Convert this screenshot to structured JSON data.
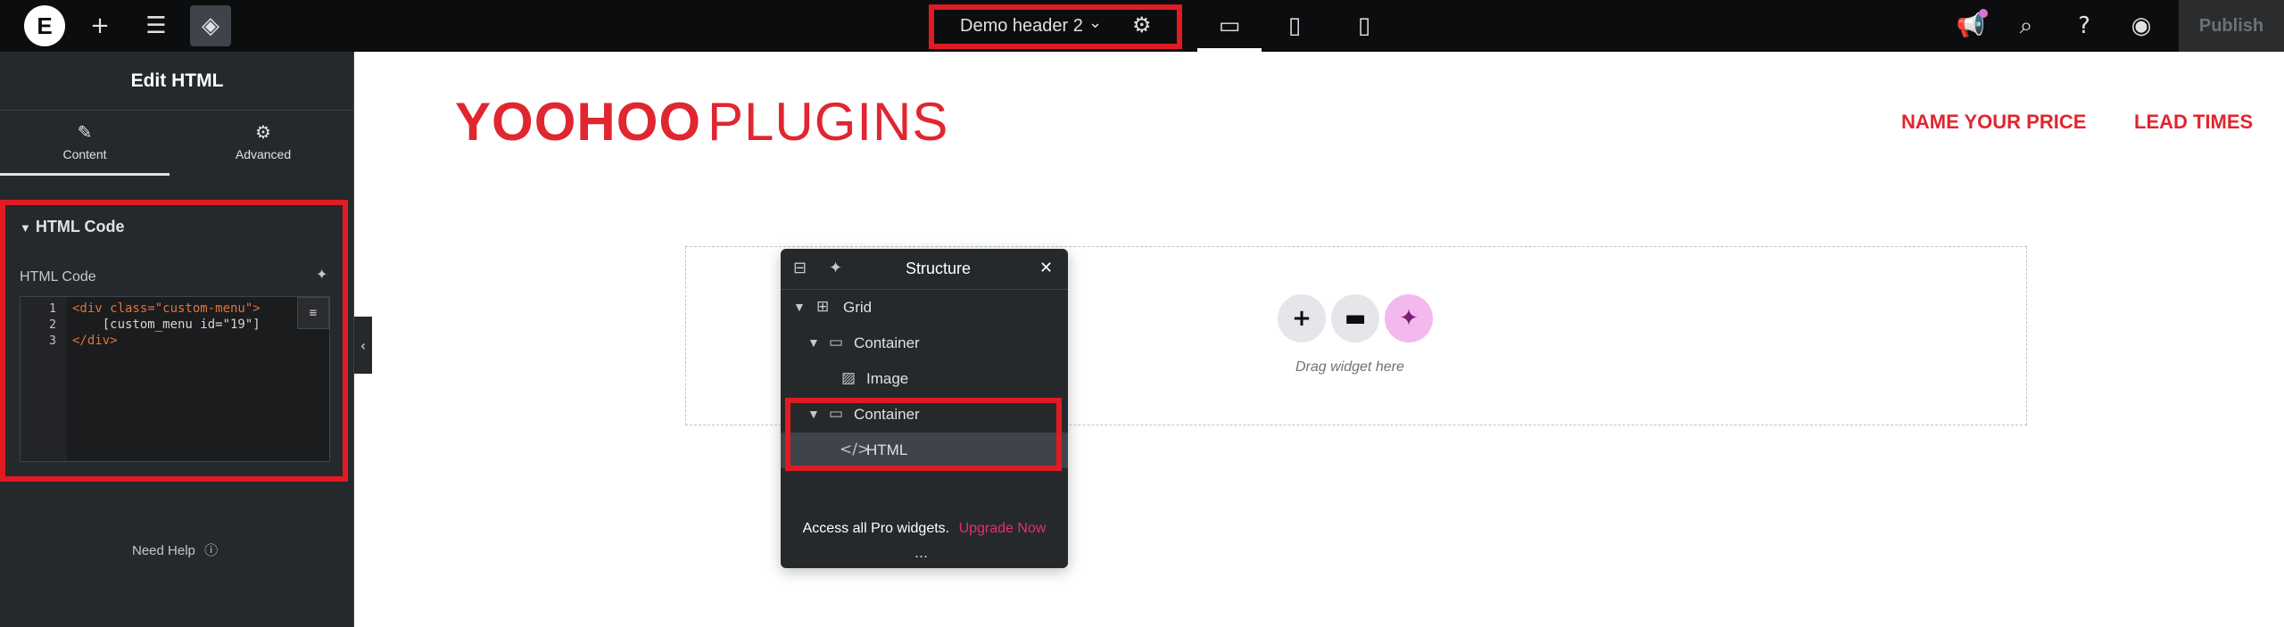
{
  "topbar": {
    "logo_icon": "elementor-logo-icon",
    "logo_glyph": "E",
    "add_icon": "plus-icon",
    "settings_icon": "sliders-icon",
    "layers_icon": "layers-icon",
    "document_title": "Demo header 2",
    "document_chevron": "chevron-down-icon",
    "document_settings_icon": "gear-icon",
    "devices": [
      "desktop-icon",
      "tablet-icon",
      "mobile-icon"
    ],
    "right_icons": [
      "megaphone-icon",
      "search-icon",
      "help-icon",
      "eye-icon"
    ],
    "publish_label": "Publish"
  },
  "panel": {
    "title": "Edit HTML",
    "tabs": [
      {
        "label": "Content",
        "icon": "pencil-icon"
      },
      {
        "label": "Advanced",
        "icon": "gear-icon"
      }
    ],
    "section_title": "HTML Code",
    "field_label": "HTML Code",
    "ai_icon": "sparkle-icon",
    "code_lines": [
      {
        "num": "1",
        "text": "<div class=\"custom-menu\">"
      },
      {
        "num": "2",
        "text": "    [custom_menu id=\"19\"]"
      },
      {
        "num": "3",
        "text": "</div>"
      }
    ],
    "need_help": "Need Help",
    "help_icon": "question-circle-icon"
  },
  "canvas": {
    "logo_bold": "YOOHOO",
    "logo_light": "PLUGINS",
    "menu": [
      "NAME YOUR PRICE",
      "LEAD TIMES"
    ],
    "drop_hint": "Drag widget here",
    "drop_buttons": [
      "plus-icon",
      "folder-icon",
      "sparkle-icon"
    ]
  },
  "structure": {
    "title": "Structure",
    "tree": [
      {
        "label": "Grid",
        "icon": "grid-icon"
      },
      {
        "label": "Container",
        "icon": "container-icon"
      },
      {
        "label": "Image",
        "icon": "image-icon"
      },
      {
        "label": "Container",
        "icon": "container-icon"
      },
      {
        "label": "HTML",
        "icon": "code-icon"
      }
    ],
    "footer_text": "Access all Pro widgets.",
    "footer_link": "Upgrade Now",
    "more": "..."
  },
  "colors": {
    "brand_red": "#e0262f",
    "highlight_red": "#e01b24",
    "panel_bg": "#26292c",
    "topbar_bg": "#0c0d0e",
    "upgrade_pink": "#e2306c"
  }
}
